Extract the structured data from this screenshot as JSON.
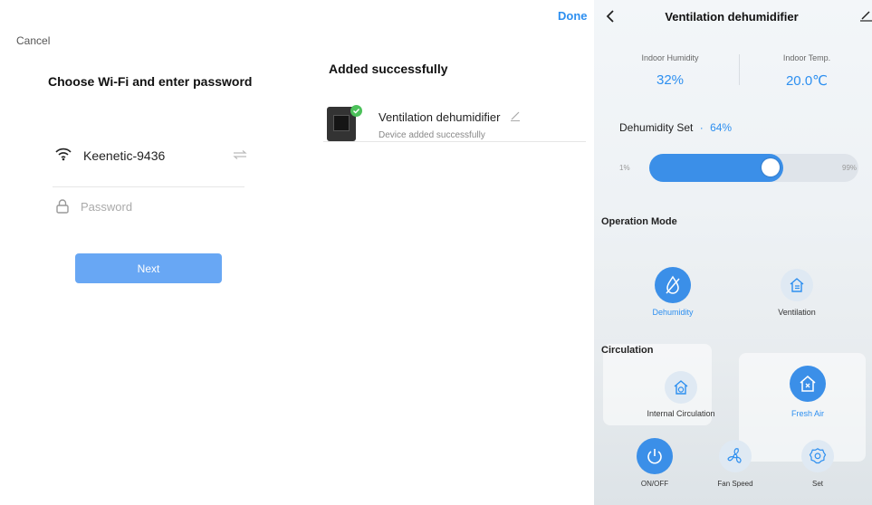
{
  "wifi_screen": {
    "cancel": "Cancel",
    "title": "Choose Wi-Fi and enter password",
    "network_name": "Keenetic-9436",
    "password_placeholder": "Password",
    "next": "Next"
  },
  "added_screen": {
    "done": "Done",
    "title": "Added successfully",
    "device_name": "Ventilation dehumidifier",
    "device_status": "Device added successfully"
  },
  "control_screen": {
    "title": "Ventilation dehumidifier",
    "indoor_humidity_label": "Indoor Humidity",
    "indoor_humidity_value": "32%",
    "indoor_temp_label": "Indoor Temp.",
    "indoor_temp_value": "20.0℃",
    "dehumidity_set_label": "Dehumidity Set",
    "dehumidity_set_sep": "·",
    "dehumidity_set_value": "64%",
    "slider": {
      "min_label": "1%",
      "max_label": "99%",
      "value_fraction": 0.64
    },
    "operation_mode_title": "Operation Mode",
    "mode_dehumidity": "Dehumidity",
    "mode_ventilation": "Ventilation",
    "circulation_title": "Circulation",
    "circ_internal": "Internal Circulation",
    "circ_fresh": "Fresh Air",
    "onoff": "ON/OFF",
    "fan_speed": "Fan Speed",
    "set": "Set",
    "accent_color": "#3b8fe8"
  }
}
